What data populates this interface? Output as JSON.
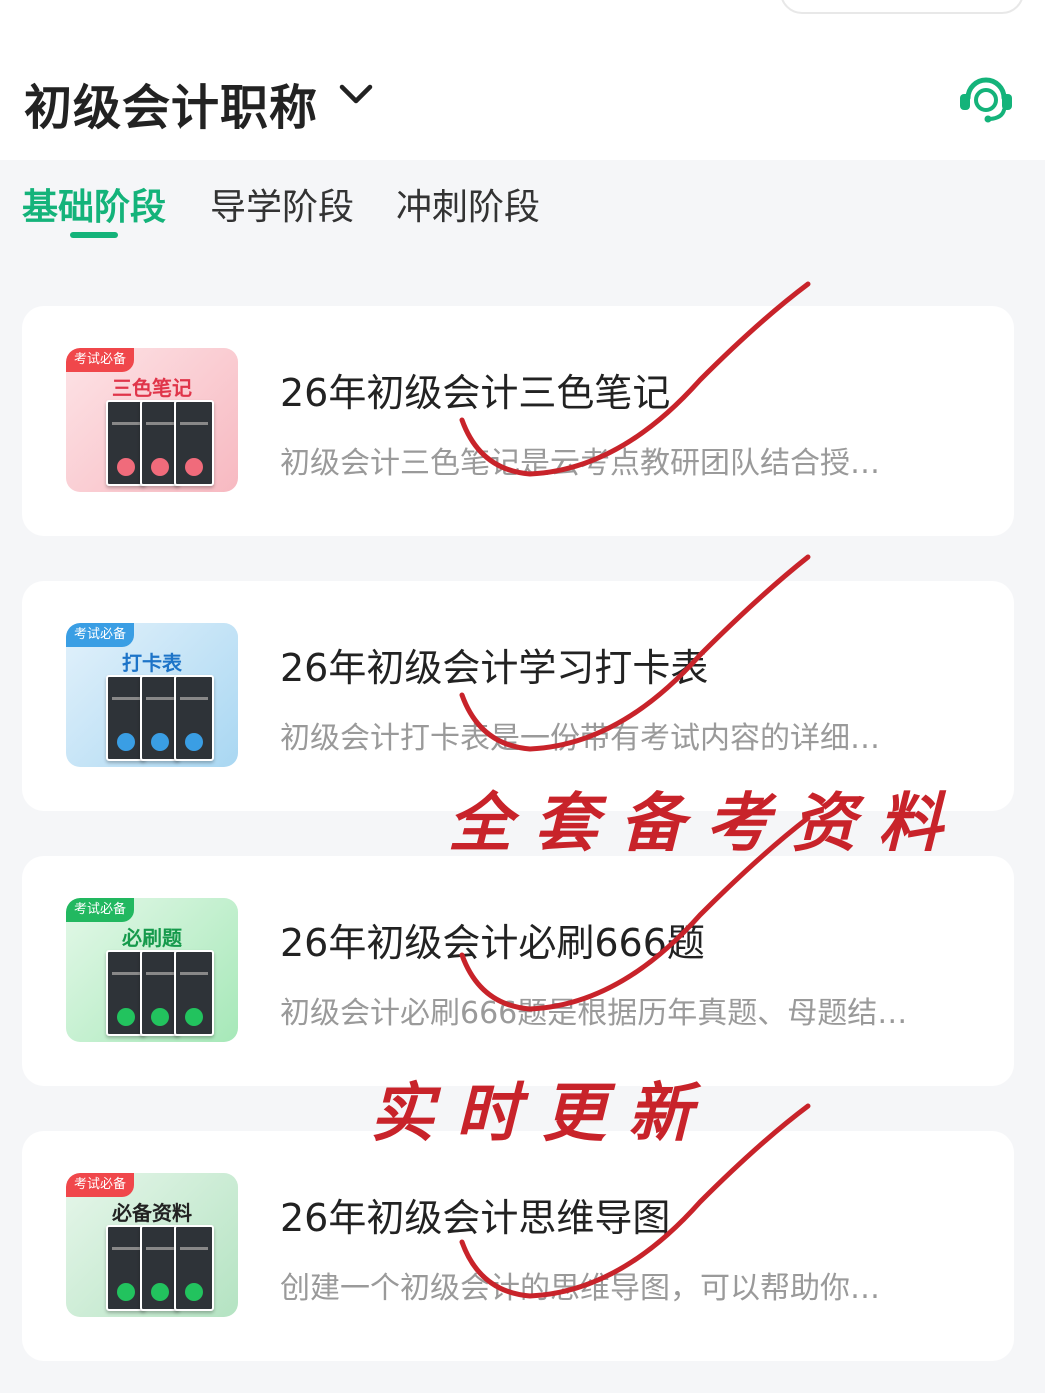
{
  "header": {
    "title": "初级会计职称",
    "dropdown_icon": "chevron-down-icon",
    "support_icon": "headset-icon",
    "accent_color": "#14b37a"
  },
  "tabs": [
    {
      "label": "基础阶段",
      "active": true
    },
    {
      "label": "导学阶段",
      "active": false
    },
    {
      "label": "冲刺阶段",
      "active": false
    }
  ],
  "cards": [
    {
      "badge": "考试必备",
      "thumb_label": "三色笔记",
      "title": "26年初级会计三色笔记",
      "desc": "初级会计三色笔记是云考点教研团队结合授…"
    },
    {
      "badge": "考试必备",
      "thumb_label": "打卡表",
      "title": "26年初级会计学习打卡表",
      "desc": "初级会计打卡表是一份带有考试内容的详细…"
    },
    {
      "badge": "考试必备",
      "thumb_label": "必刷题",
      "title": "26年初级会计必刷666题",
      "desc": "初级会计必刷666题是根据历年真题、母题结…"
    },
    {
      "badge": "考试必备",
      "thumb_label": "必备资料",
      "title": "26年初级会计思维导图",
      "desc": "创建一个初级会计的思维导图，可以帮助你…"
    }
  ],
  "annotations": {
    "line1": "全套备考资料",
    "line2": "实时更新",
    "ink_color": "#c8232a"
  }
}
